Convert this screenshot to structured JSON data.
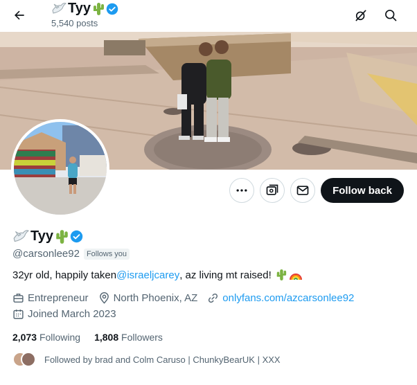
{
  "header": {
    "name": "Tyy",
    "posts_count": "5,540 posts"
  },
  "actions": {
    "follow_label": "Follow back"
  },
  "profile": {
    "display_name": "Tyy",
    "handle": "@carsonlee92",
    "follows_you": "Follows you",
    "bio_text": "32yr old, happily taken ",
    "bio_mention": "@israeljcarey",
    "bio_tail": ", az living mt raised!",
    "profession": "Entrepreneur",
    "location": "North Phoenix, AZ",
    "website": "onlyfans.com/azcarsonlee92",
    "joined": "Joined March 2023"
  },
  "stats": {
    "following_count": "2,073",
    "following_label": "Following",
    "followers_count": "1,808",
    "followers_label": "Followers"
  },
  "followed_by": "Followed by brad and Colm Caruso | ChunkyBearUK | XXX",
  "colors": {
    "accent": "#1d9bf0",
    "verified": "#1d9bf0",
    "text": "#0f1419",
    "muted": "#536471"
  }
}
